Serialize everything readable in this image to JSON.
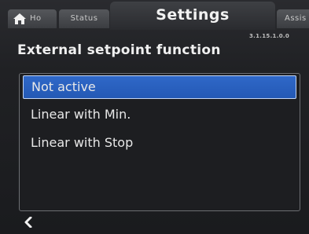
{
  "tabs": {
    "home": {
      "label": "Ho",
      "icon": "home-icon"
    },
    "status": {
      "label": "Status"
    },
    "settings": {
      "label": "Settings"
    },
    "assist": {
      "label": "Assis"
    }
  },
  "page": {
    "title": "External setpoint function",
    "code": "3.1.15.1.0.0"
  },
  "options": [
    {
      "label": "Not active",
      "selected": true
    },
    {
      "label": "Linear with Min.",
      "selected": false
    },
    {
      "label": "Linear with Stop",
      "selected": false
    }
  ],
  "footer": {
    "back_icon": "chevron-left-icon"
  },
  "colors": {
    "selection": "#2a62c0",
    "background": "#1c1d20",
    "text": "#e8e8e8"
  }
}
